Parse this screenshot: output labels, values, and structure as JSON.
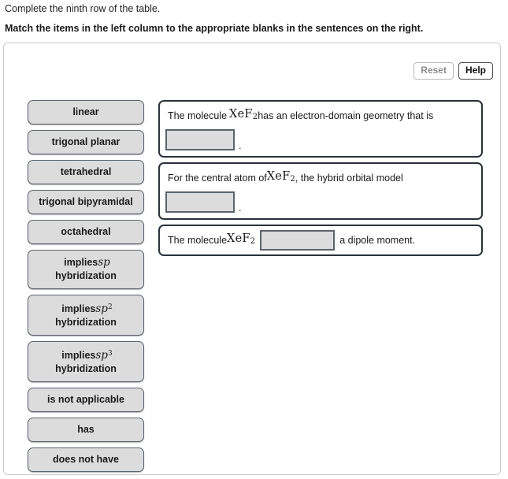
{
  "header": {
    "prompt": "Complete the ninth row of the table.",
    "instruction": "Match the items in the left column to the appropriate blanks in the sentences on the right."
  },
  "toolbar": {
    "reset_label": "Reset",
    "help_label": "Help",
    "reset_state": "disabled",
    "help_state": "enabled"
  },
  "bank": {
    "items": [
      {
        "text": "linear",
        "lines": [
          "linear"
        ]
      },
      {
        "text": "trigonal planar",
        "lines": [
          "trigonal planar"
        ]
      },
      {
        "text": "tetrahedral",
        "lines": [
          "tetrahedral"
        ]
      },
      {
        "text": "trigonal bipyramidal",
        "lines": [
          "trigonal bipyramidal"
        ]
      },
      {
        "text": "octahedral",
        "lines": [
          "octahedral"
        ]
      },
      {
        "text": "implies sp hybridization",
        "lines": [
          "implies sp",
          "hybridization"
        ],
        "math": "sp"
      },
      {
        "text": "implies sp2 hybridization",
        "lines": [
          "implies sp2",
          "hybridization"
        ],
        "math": "sp",
        "exp": "2"
      },
      {
        "text": "implies sp3 hybridization",
        "lines": [
          "implies sp3",
          "hybridization"
        ],
        "math": "sp",
        "exp": "3"
      },
      {
        "text": "is not applicable",
        "lines": [
          "is not applicable"
        ]
      },
      {
        "text": "has",
        "lines": [
          "has"
        ]
      },
      {
        "text": "does not have",
        "lines": [
          "does not have"
        ]
      }
    ],
    "prefix_implies": "implies",
    "suffix_hybridization": "hybridization"
  },
  "cards": [
    {
      "id": "card-electron-domain-geometry",
      "lead_text": "The molecule",
      "formula": "XeF",
      "formula_sub": "2",
      "tail_text": "has an electron-domain geometry that is",
      "blank_value": "",
      "blank_position": "next-line",
      "trailing_punctuation": "."
    },
    {
      "id": "card-hybrid-orbital-model",
      "lead_text": "For the central atom of",
      "formula": "XeF",
      "formula_sub": "2",
      "tail_text": ", the hybrid orbital model",
      "blank_value": "",
      "blank_position": "next-line",
      "trailing_punctuation": "."
    },
    {
      "id": "card-dipole-moment",
      "lead_text": "The molecule",
      "formula": "XeF",
      "formula_sub": "2",
      "tail_text": "a dipole moment.",
      "blank_value": "",
      "blank_position": "inline",
      "trailing_punctuation": ""
    }
  ],
  "colors": {
    "item_fill": "#dcdcdc",
    "item_border": "#5d636b",
    "card_border": "#2a3138",
    "panel_border": "#c9c9c9",
    "text": "#1a1a1a",
    "disabled_text": "#8c8c8c"
  }
}
